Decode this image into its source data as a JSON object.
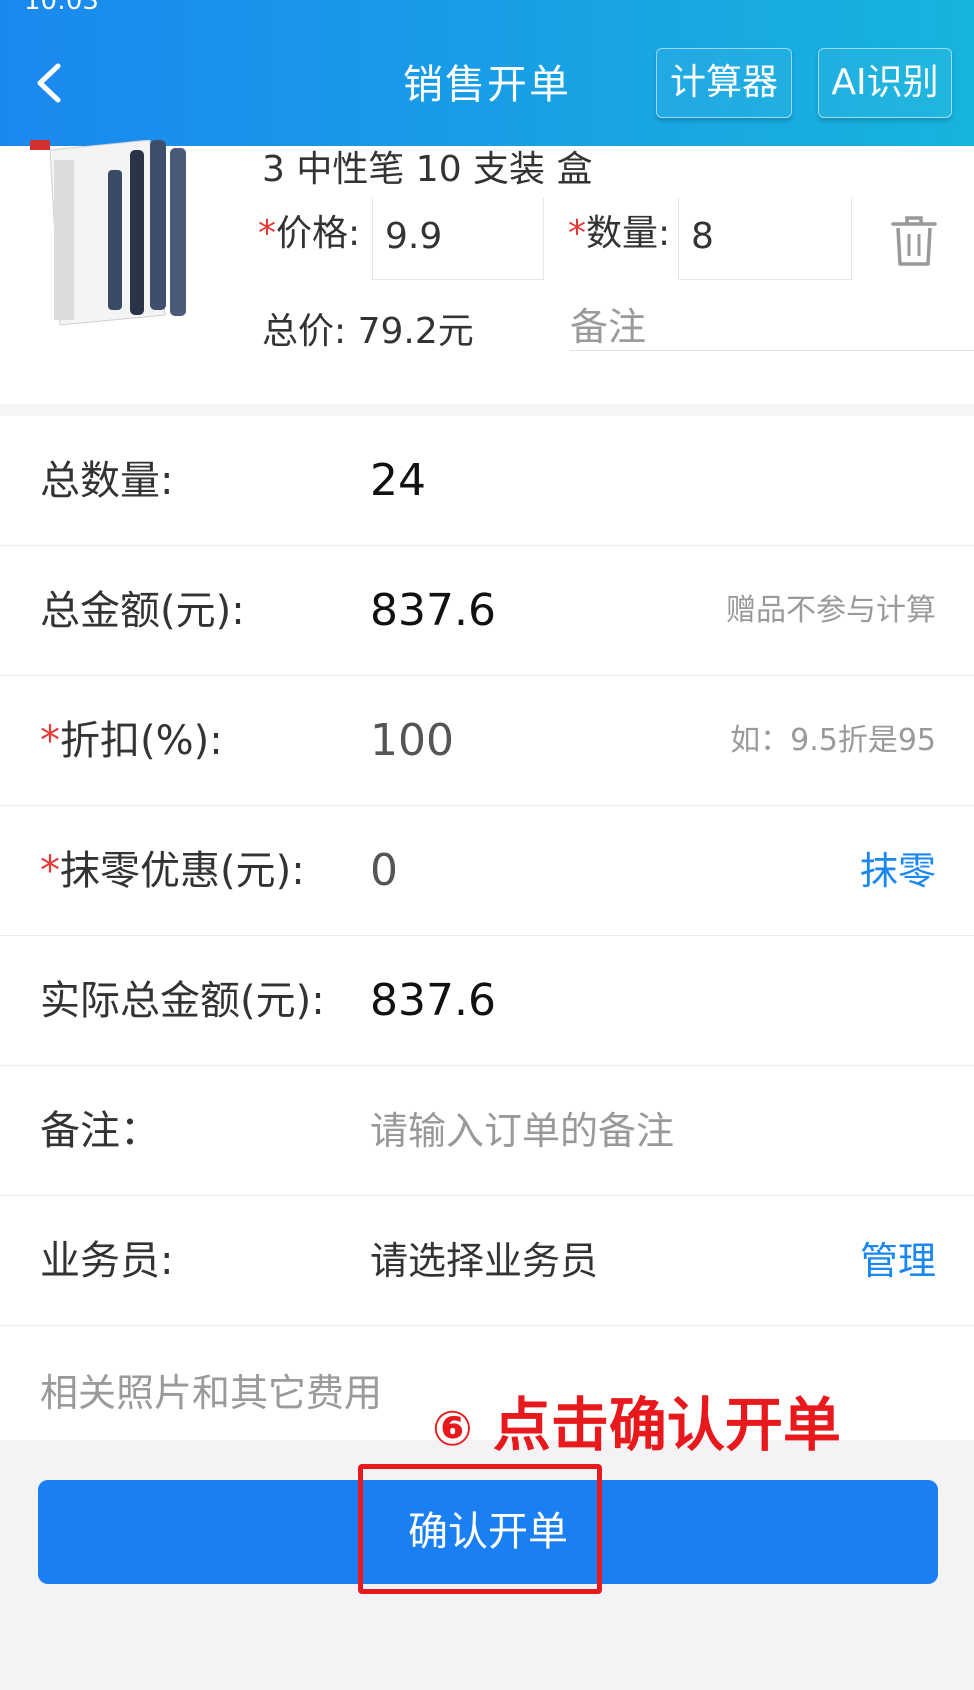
{
  "status_bar": {
    "time": "10:03"
  },
  "header": {
    "title": "销售开单",
    "calculator_label": "计算器",
    "ai_label": "AI识别",
    "background": [
      "#1a88f0",
      "#17b4dc"
    ]
  },
  "product": {
    "name": "3 中性笔 10 支装 盒",
    "price_label": "价格:",
    "price_value": "9.9",
    "qty_label": "数量:",
    "qty_value": "8",
    "required_mark": "*",
    "total_label": "总价:",
    "total_value": "79.2元",
    "remark_placeholder": "备注"
  },
  "form": {
    "total_qty": {
      "label": "总数量:",
      "value": "24"
    },
    "total_amount": {
      "label": "总金额(元):",
      "value": "837.6",
      "hint": "赠品不参与计算"
    },
    "discount": {
      "label": "折扣(%):",
      "value": "100",
      "hint": "如：9.5折是95"
    },
    "rounding": {
      "label": "抹零优惠(元):",
      "value": "0",
      "link": "抹零"
    },
    "actual_amount": {
      "label": "实际总金额(元):",
      "value": "837.6"
    },
    "remark": {
      "label": "备注：",
      "placeholder": "请输入订单的备注"
    },
    "salesman": {
      "label": "业务员:",
      "value": "请选择业务员",
      "link": "管理"
    },
    "photos_label": "相关照片和其它费用"
  },
  "annotation": {
    "number": "⑥",
    "text": "点击确认开单"
  },
  "confirm_button": {
    "label": "确认开单"
  },
  "colors": {
    "accent": "#1a7ff0",
    "required": "#e53935",
    "annotation": "#e8191c"
  }
}
